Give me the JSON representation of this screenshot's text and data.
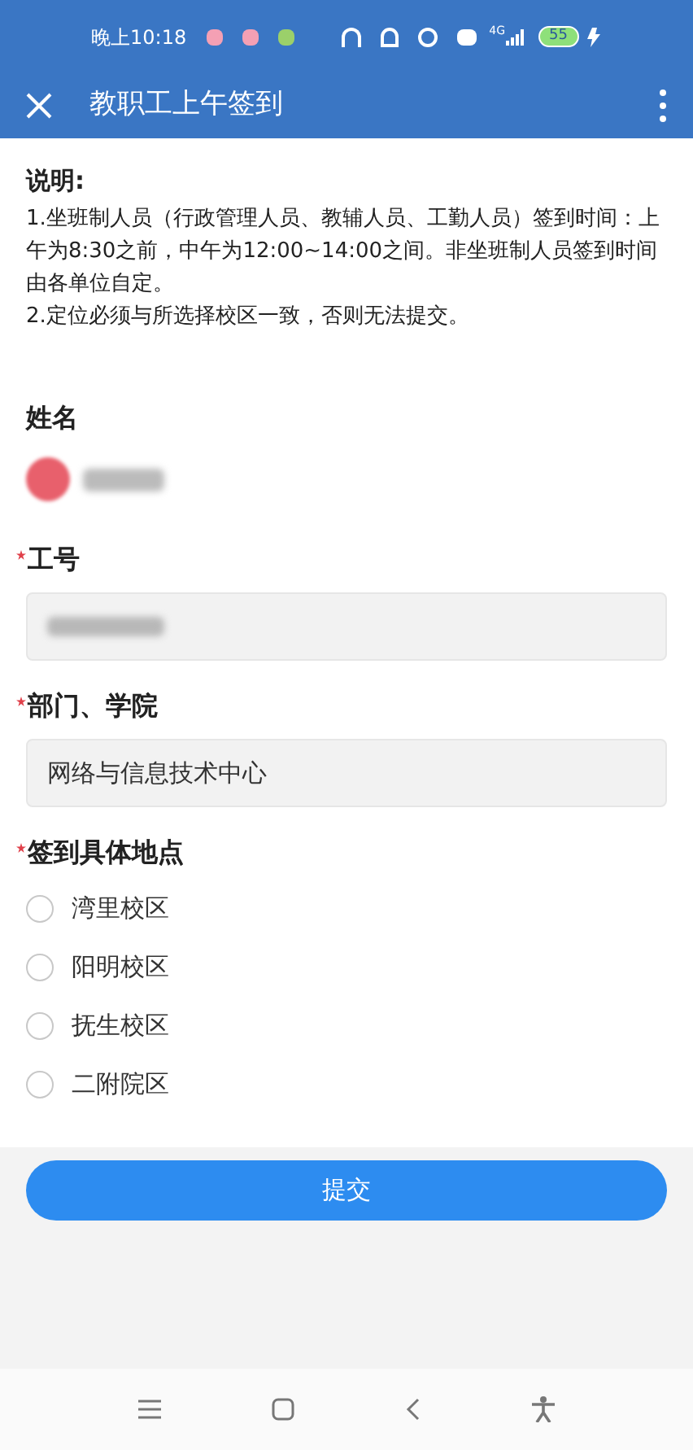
{
  "status_bar": {
    "time": "晚上10:18",
    "network": "4G",
    "battery": "55"
  },
  "app_bar": {
    "title": "教职工上午签到"
  },
  "notice": {
    "heading": "说明:",
    "lines": [
      "1.坐班制人员（行政管理人员、教辅人员、工勤人员）签到时间：上午为8:30之前，中午为12:00~14:00之间。非坐班制人员签到时间由各单位自定。",
      "2.定位必须与所选择校区一致，否则无法提交。"
    ]
  },
  "fields": [
    {
      "kind": "person",
      "label": "姓名",
      "required": false
    },
    {
      "kind": "redacted",
      "label": "工号",
      "required": true
    },
    {
      "kind": "text",
      "label": "部门、学院",
      "required": true,
      "value": "网络与信息技术中心"
    },
    {
      "kind": "radio",
      "label": "签到具体地点",
      "required": true,
      "options": [
        {
          "label": "湾里校区",
          "selected": false
        },
        {
          "label": "阳明校区",
          "selected": false
        },
        {
          "label": "抚生校区",
          "selected": false
        },
        {
          "label": "二附院区",
          "selected": false
        }
      ]
    }
  ],
  "submit": {
    "label": "提交"
  }
}
